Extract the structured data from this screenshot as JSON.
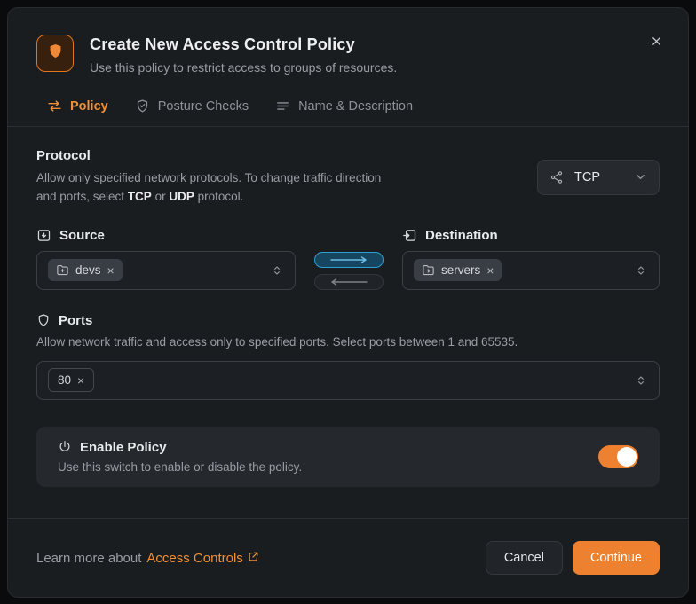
{
  "dialog": {
    "title": "Create New Access Control Policy",
    "subtitle": "Use this policy to restrict access to groups of resources."
  },
  "tabs": {
    "policy": "Policy",
    "posture_checks": "Posture Checks",
    "name_description": "Name & Description",
    "active_tab": "Policy"
  },
  "protocol": {
    "heading": "Protocol",
    "desc_before": "Allow only specified network protocols. To change traffic direction and ports, select ",
    "tcp": "TCP",
    "desc_mid": " or ",
    "udp": "UDP",
    "desc_after": " protocol.",
    "selected": "TCP"
  },
  "source": {
    "heading": "Source",
    "tag": "devs"
  },
  "destination": {
    "heading": "Destination",
    "tag": "servers"
  },
  "traffic_direction": {
    "active": "left-to-right"
  },
  "ports": {
    "heading": "Ports",
    "description": "Allow network traffic and access only to specified ports. Select ports between 1 and 65535.",
    "tag": "80"
  },
  "enable_policy": {
    "heading": "Enable Policy",
    "description": "Use this switch to enable or disable the policy.",
    "state": "on"
  },
  "footer": {
    "learn_prefix": "Learn more about",
    "link_label": "Access Controls",
    "cancel": "Cancel",
    "continue": "Continue"
  },
  "glyphs": {
    "remove_tag": "×"
  },
  "icons": {
    "header": "shield-icon",
    "close": "close-icon",
    "tab_policy": "swap-arrows-icon",
    "tab_posture_checks": "shield-check-icon",
    "tab_name_description": "lines-icon",
    "protocol_select": "network-share-icon",
    "source_heading": "tray-arrow-down-icon",
    "destination_heading": "tray-arrow-in-icon",
    "source_tag": "folder-plus-icon",
    "destination_tag": "folder-move-icon",
    "ports_heading": "shield-outline-icon",
    "enable_policy": "power-icon",
    "link": "external-link-icon"
  },
  "colors": {
    "accent_orange": "#ee8130",
    "orange_text": "#ef9038",
    "direction_active_border": "#2f9fd6",
    "direction_active_fill": "#15455f",
    "toggle_on": "#ee8130",
    "modal_background": "#1a1d20",
    "card_background": "#25282d"
  }
}
